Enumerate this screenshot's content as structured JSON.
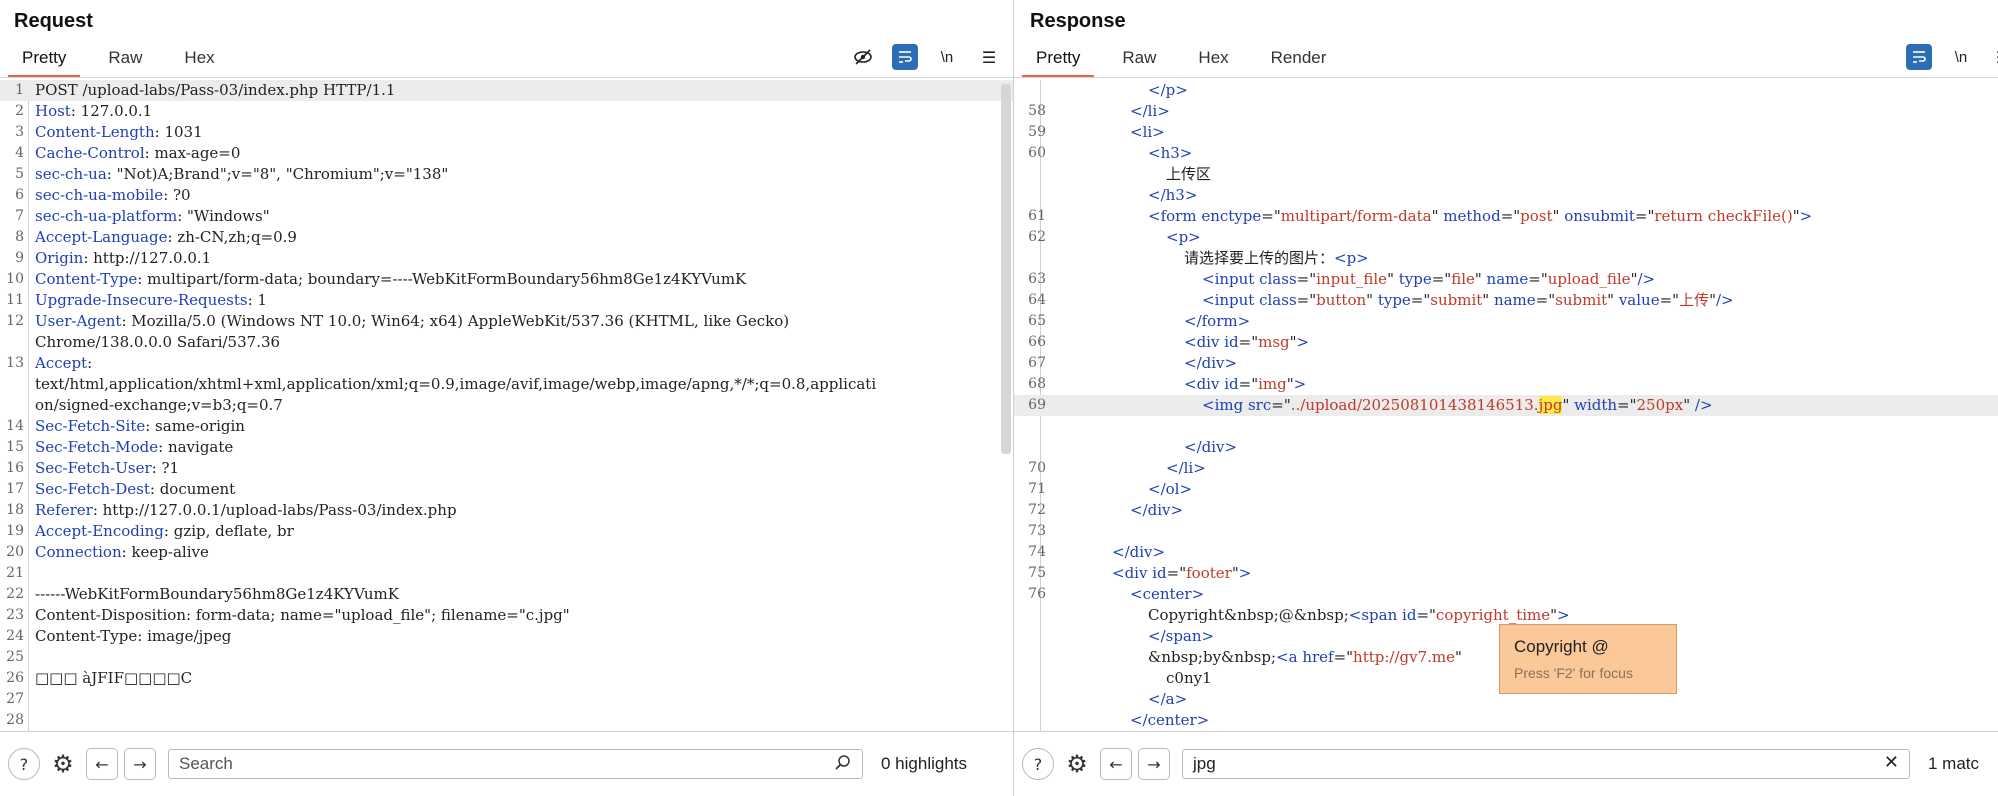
{
  "request": {
    "title": "Request",
    "tabs": [
      "Pretty",
      "Raw",
      "Hex"
    ],
    "lines": [
      {
        "n": "1",
        "k": "POST /upload-labs/Pass-03/index.php HTTP/1.1",
        "v": ""
      },
      {
        "n": "2",
        "k": "Host",
        "v": ": 127.0.0.1"
      },
      {
        "n": "3",
        "k": "Content-Length",
        "v": ": 1031"
      },
      {
        "n": "4",
        "k": "Cache-Control",
        "v": ": max-age=0"
      },
      {
        "n": "5",
        "k": "sec-ch-ua",
        "v": ": \"Not)A;Brand\";v=\"8\", \"Chromium\";v=\"138\""
      },
      {
        "n": "6",
        "k": "sec-ch-ua-mobile",
        "v": ": ?0"
      },
      {
        "n": "7",
        "k": "sec-ch-ua-platform",
        "v": ": \"Windows\""
      },
      {
        "n": "8",
        "k": "Accept-Language",
        "v": ": zh-CN,zh;q=0.9"
      },
      {
        "n": "9",
        "k": "Origin",
        "v": ": http://127.0.0.1"
      },
      {
        "n": "10",
        "k": "Content-Type",
        "v": ": multipart/form-data; boundary=----WebKitFormBoundary56hm8Ge1z4KYVumK"
      },
      {
        "n": "11",
        "k": "Upgrade-Insecure-Requests",
        "v": ": 1"
      },
      {
        "n": "12",
        "k": "User-Agent",
        "v": ": Mozilla/5.0 (Windows NT 10.0; Win64; x64) AppleWebKit/537.36 (KHTML, like Gecko)"
      },
      {
        "n": "",
        "k": "",
        "v": "Chrome/138.0.0.0 Safari/537.36"
      },
      {
        "n": "13",
        "k": "Accept",
        "v": ":"
      },
      {
        "n": "",
        "k": "",
        "v": "text/html,application/xhtml+xml,application/xml;q=0.9,image/avif,image/webp,image/apng,*/*;q=0.8,applicati"
      },
      {
        "n": "",
        "k": "",
        "v": "on/signed-exchange;v=b3;q=0.7"
      },
      {
        "n": "14",
        "k": "Sec-Fetch-Site",
        "v": ": same-origin"
      },
      {
        "n": "15",
        "k": "Sec-Fetch-Mode",
        "v": ": navigate"
      },
      {
        "n": "16",
        "k": "Sec-Fetch-User",
        "v": ": ?1"
      },
      {
        "n": "17",
        "k": "Sec-Fetch-Dest",
        "v": ": document"
      },
      {
        "n": "18",
        "k": "Referer",
        "v": ": http://127.0.0.1/upload-labs/Pass-03/index.php"
      },
      {
        "n": "19",
        "k": "Accept-Encoding",
        "v": ": gzip, deflate, br"
      },
      {
        "n": "20",
        "k": "Connection",
        "v": ": keep-alive"
      },
      {
        "n": "21",
        "k": "",
        "v": ""
      },
      {
        "n": "22",
        "k": "",
        "v": "------WebKitFormBoundary56hm8Ge1z4KYVumK"
      },
      {
        "n": "23",
        "k": "",
        "v": "Content-Disposition: form-data; name=\"upload_file\"; filename=\"c.jpg\""
      },
      {
        "n": "24",
        "k": "",
        "v": "Content-Type: image/jpeg"
      },
      {
        "n": "25",
        "k": "",
        "v": ""
      },
      {
        "n": "26",
        "k": "",
        "v": "□□□ àJFIF□□□□C"
      },
      {
        "n": "27",
        "k": "",
        "v": ""
      },
      {
        "n": "28",
        "k": "",
        "v": ""
      }
    ],
    "search_placeholder": "Search",
    "highlights": "0 highlights"
  },
  "response": {
    "title": "Response",
    "tabs": [
      "Pretty",
      "Raw",
      "Hex",
      "Render"
    ],
    "lines": [
      {
        "n": "",
        "i": 104,
        "h": "<span class='tag'>&lt;/p&gt;</span>"
      },
      {
        "n": "58",
        "i": 86,
        "h": "<span class='tag'>&lt;/li&gt;</span>"
      },
      {
        "n": "59",
        "i": 86,
        "h": "<span class='tag'>&lt;li&gt;</span>"
      },
      {
        "n": "60",
        "i": 104,
        "h": "<span class='tag'>&lt;h3&gt;</span>"
      },
      {
        "n": "",
        "i": 122,
        "h": "上传区"
      },
      {
        "n": "",
        "i": 104,
        "h": "<span class='tag'>&lt;/h3&gt;</span>"
      },
      {
        "n": "61",
        "i": 104,
        "h": "<span class='tag'>&lt;form</span> <span class='tag'>enctype</span>=\"<span class='attr'>multipart/form-data</span>\" <span class='tag'>method</span>=\"<span class='attr'>post</span>\" <span class='tag'>onsubmit</span>=\"<span class='attr'>return checkFile()</span>\"<span class='tag'>&gt;</span>"
      },
      {
        "n": "62",
        "i": 122,
        "h": "<span class='tag'>&lt;p&gt;</span>"
      },
      {
        "n": "",
        "i": 140,
        "h": "请选择要上传的图片：<span class='tag'>&lt;p&gt;</span>"
      },
      {
        "n": "63",
        "i": 158,
        "h": "<span class='tag'>&lt;input</span> <span class='tag'>class</span>=\"<span class='attr'>input_file</span>\" <span class='tag'>type</span>=\"<span class='attr'>file</span>\" <span class='tag'>name</span>=\"<span class='attr'>upload_file</span>\"<span class='tag'>/&gt;</span>"
      },
      {
        "n": "64",
        "i": 158,
        "h": "<span class='tag'>&lt;input</span> <span class='tag'>class</span>=\"<span class='attr'>button</span>\" <span class='tag'>type</span>=\"<span class='attr'>submit</span>\" <span class='tag'>name</span>=\"<span class='attr'>submit</span>\" <span class='tag'>value</span>=\"<span class='attr'>上传</span>\"<span class='tag'>/&gt;</span>"
      },
      {
        "n": "65",
        "i": 140,
        "h": "<span class='tag'>&lt;/form&gt;</span>"
      },
      {
        "n": "66",
        "i": 140,
        "h": "<span class='tag'>&lt;div</span> <span class='tag'>id</span>=\"<span class='attr'>msg</span>\"<span class='tag'>&gt;</span>"
      },
      {
        "n": "67",
        "i": 140,
        "h": "<span class='tag'>&lt;/div&gt;</span>"
      },
      {
        "n": "68",
        "i": 140,
        "h": "<span class='tag'>&lt;div</span> <span class='tag'>id</span>=\"<span class='attr'>img</span>\"<span class='tag'>&gt;</span>"
      },
      {
        "n": "69",
        "i": 158,
        "c": true,
        "h": "<span class='tag'>&lt;img</span> <span class='tag'>src</span>=\"<span class='attr'>../upload/202508101438146513.<span class='hl'>jpg</span></span>\" <span class='tag'>width</span>=\"<span class='attr'>250px</span>\" <span class='tag'>/&gt;</span>"
      },
      {
        "n": "",
        "i": 0,
        "h": ""
      },
      {
        "n": "",
        "i": 140,
        "h": "<span class='tag'>&lt;/div&gt;</span>"
      },
      {
        "n": "70",
        "i": 122,
        "h": "<span class='tag'>&lt;/li&gt;</span>"
      },
      {
        "n": "71",
        "i": 104,
        "h": "<span class='tag'>&lt;/ol&gt;</span>"
      },
      {
        "n": "72",
        "i": 86,
        "h": "<span class='tag'>&lt;/div&gt;</span>"
      },
      {
        "n": "73",
        "i": 0,
        "h": ""
      },
      {
        "n": "74",
        "i": 68,
        "h": "<span class='tag'>&lt;/div&gt;</span>"
      },
      {
        "n": "75",
        "i": 68,
        "h": "<span class='tag'>&lt;div</span> <span class='tag'>id</span>=\"<span class='attr'>footer</span>\"<span class='tag'>&gt;</span>"
      },
      {
        "n": "76",
        "i": 86,
        "h": "<span class='tag'>&lt;center&gt;</span>"
      },
      {
        "n": "",
        "i": 104,
        "h": "Copyright&amp;nbsp;@&amp;nbsp;<span class='tag'>&lt;span</span> <span class='tag'>id</span>=\"<span class='attr'>copyright_time</span>\"<span class='tag'>&gt;</span>"
      },
      {
        "n": "",
        "i": 104,
        "h": "<span class='tag'>&lt;/span&gt;</span>"
      },
      {
        "n": "",
        "i": 104,
        "h": "&amp;nbsp;by&amp;nbsp;<span class='tag'>&lt;a</span> <span class='tag'>href</span>=\"<span class='attr'>http://gv7.me</span>\""
      },
      {
        "n": "",
        "i": 122,
        "h": "c0ny1"
      },
      {
        "n": "",
        "i": 104,
        "h": "<span class='tag'>&lt;/a&gt;</span>"
      },
      {
        "n": "",
        "i": 86,
        "h": "<span class='tag'>&lt;/center&gt;</span>"
      }
    ],
    "search_value": "jpg",
    "matches": "1 matc"
  },
  "tooltip": {
    "title": "Copyright @",
    "hint": "Press 'F2' for focus"
  },
  "colors": {
    "accent": "#e8663d",
    "button_blue": "#2d6db5",
    "tooltip_bg": "#fbc89a",
    "highlight": "#ffe94a"
  }
}
